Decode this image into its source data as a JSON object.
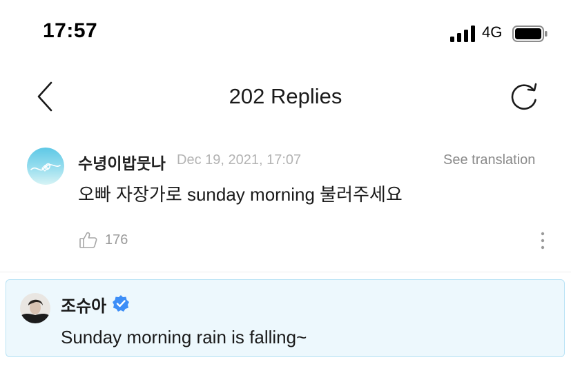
{
  "status_bar": {
    "time": "17:57",
    "network": "4G",
    "icons": [
      "signal-icon",
      "battery-icon"
    ]
  },
  "header": {
    "title": "202 Replies",
    "back_icon": "chevron-left-icon",
    "refresh_icon": "refresh-icon"
  },
  "comment": {
    "author": "수녕이밥뭇나",
    "date": "Dec 19, 2021, 17:07",
    "translate_label": "See translation",
    "text": "오빠 자장가로 sunday morning 불러주세요",
    "likes": "176",
    "icons": [
      "avatar",
      "thumbs-up-icon",
      "more-vertical-icon"
    ]
  },
  "artist_reply": {
    "author": "조슈아",
    "verified_icon": "verified-badge-icon",
    "text": "Sunday morning rain is falling~"
  },
  "colors": {
    "reply_background": "#edf8fd",
    "reply_border": "#b9e3f5",
    "verified_blue": "#3d8ef7",
    "muted_text": "#b3b3b3"
  }
}
